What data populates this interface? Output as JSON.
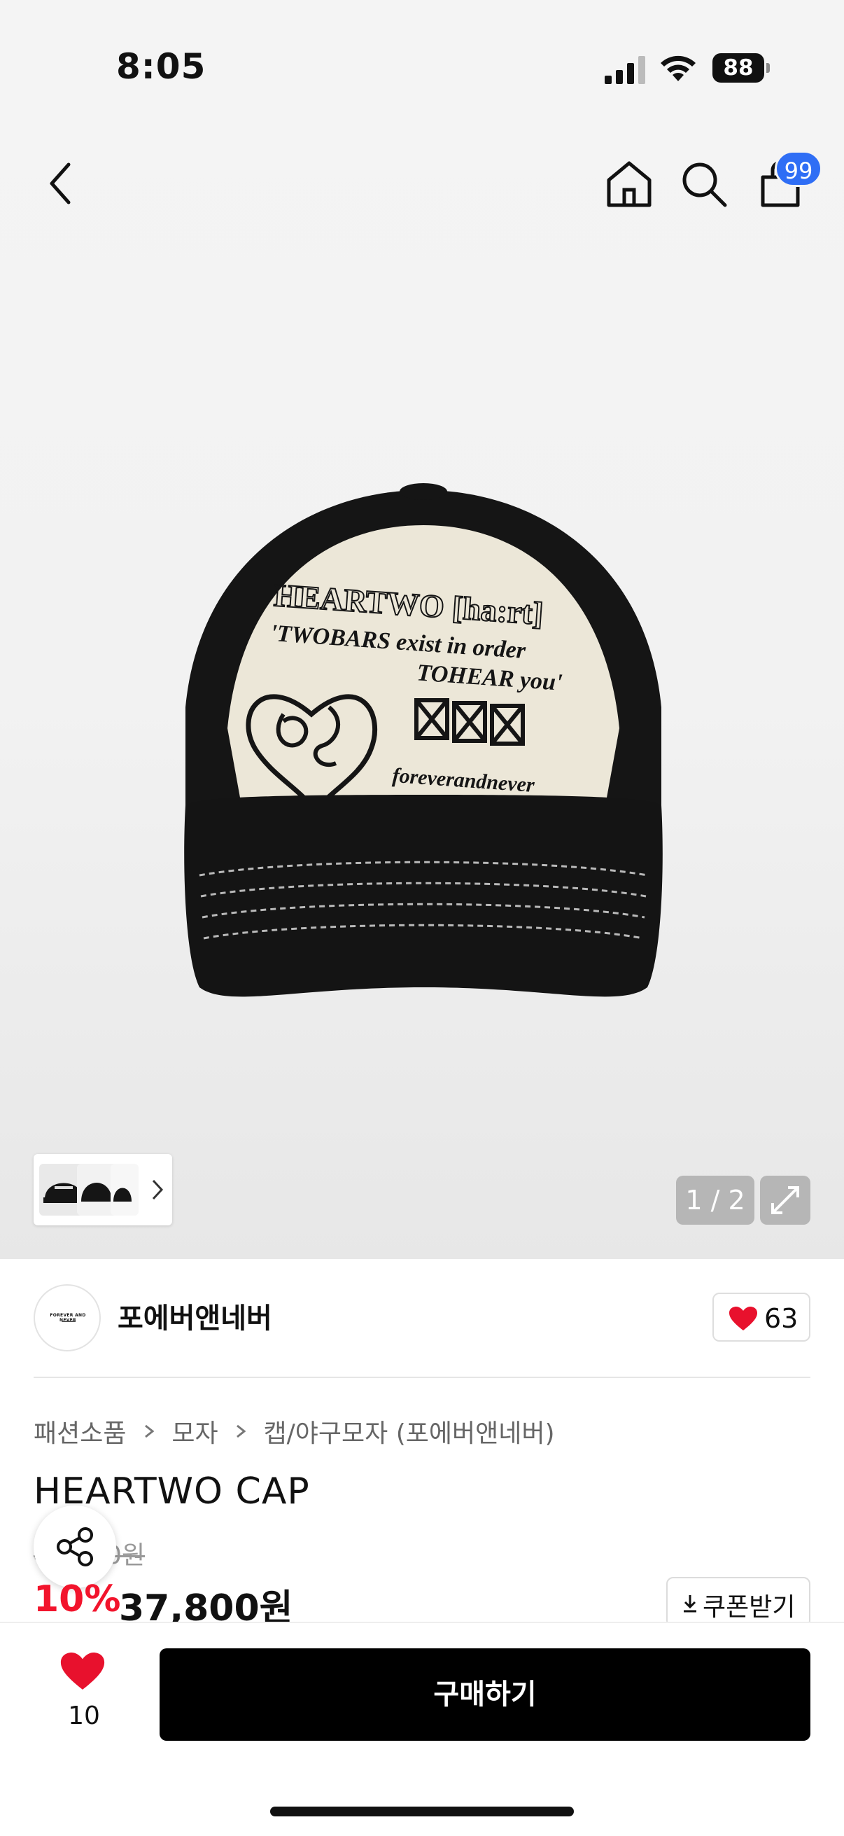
{
  "status_bar": {
    "time": "8:05",
    "battery": "88",
    "icons": [
      "signal-icon",
      "wifi-icon",
      "battery-icon"
    ]
  },
  "nav": {
    "icons": [
      "back-chevron-icon",
      "home-icon",
      "search-icon",
      "shopping-bag-icon"
    ],
    "cart_badge": "99",
    "badge_color": "#2f6ef5"
  },
  "gallery": {
    "page_indicator": "1 / 2",
    "product_image_text": {
      "line1": "HEARTWO [ha:rt]",
      "line2": "'TWOBARS exist in order",
      "line3": "TOHEAR you'",
      "line4": "foreverandnever"
    }
  },
  "brand": {
    "name": "포에버앤네버",
    "logo_text": "FOREVER AND NEVER",
    "like_count": "63"
  },
  "breadcrumb": [
    "패션소품",
    "모자",
    "캡/야구모자 (포에버앤네버)"
  ],
  "product": {
    "title": "HEARTWO CAP",
    "original_price": "42,000원",
    "discount": "10%",
    "sale_price": "37,800원",
    "coupon_label": "쿠폰받기"
  },
  "bottom_bar": {
    "wish_count": "10",
    "buy_label": "구매하기"
  },
  "colors": {
    "accent_red": "#f2142c",
    "heart_red": "#e8112d",
    "buy_button": "#000000"
  }
}
